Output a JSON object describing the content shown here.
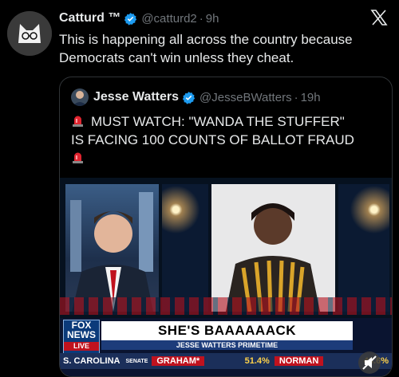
{
  "tweet": {
    "display_name": "Catturd ™",
    "handle": "@catturd2",
    "time": "9h",
    "text": "This is happening all across the country because Democrats can't win unless they cheat."
  },
  "quote": {
    "display_name": "Jesse Watters",
    "handle": "@JesseBWatters",
    "time": "19h",
    "text_line1": "MUST WATCH: \"WANDA THE STUFFER\"",
    "text_line2": "IS FACING 100 COUNTS OF BALLOT FRAUD"
  },
  "video": {
    "logo_line1": "FOX",
    "logo_line2": "NEWS",
    "logo_live": "LIVE",
    "headline": "SHE'S BAAAAAACK",
    "subline": "JESSE WATTERS PRIMETIME",
    "ticker": {
      "state": "S. CAROLINA",
      "race": "SENATE",
      "candidate1": "GRAHAM*",
      "pct1": "51.4%",
      "candidate2": "NORMAN",
      "pct2": "48.6%"
    }
  },
  "colors": {
    "verified": "#1d9bf0",
    "muted_text": "#71767b",
    "border": "#2f3336",
    "fox_red": "#c0121e"
  },
  "icons": [
    "verified-badge-icon",
    "x-logo-icon",
    "police-light-icon",
    "mute-icon"
  ]
}
